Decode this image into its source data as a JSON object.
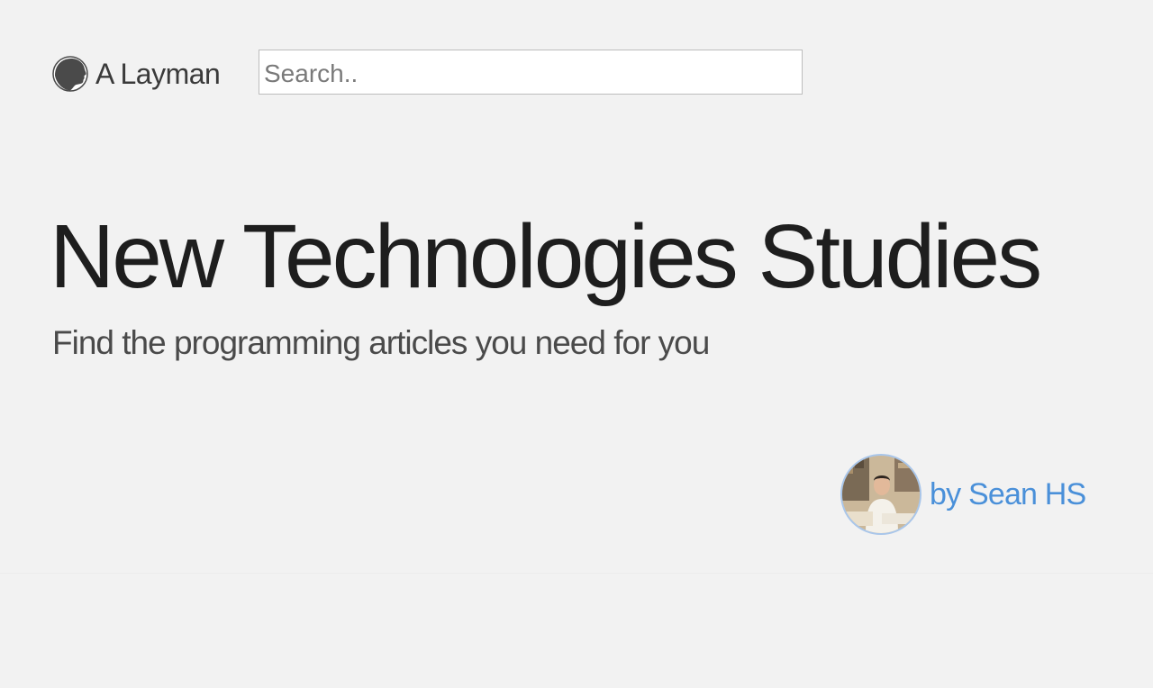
{
  "header": {
    "brand": {
      "name": "A Layman",
      "logo_icon": "silhouette-head-icon"
    },
    "search": {
      "placeholder": "Search..",
      "value": ""
    }
  },
  "hero": {
    "title": "New Technologies Studies",
    "subtitle": "Find the programming articles you need for you"
  },
  "author": {
    "label": "by Sean HS",
    "avatar_icon": "author-photo"
  },
  "colors": {
    "background": "#f2f2f2",
    "title_text": "#1e1e1e",
    "link_blue": "#4a90d9",
    "avatar_border": "#a9c6ea"
  }
}
